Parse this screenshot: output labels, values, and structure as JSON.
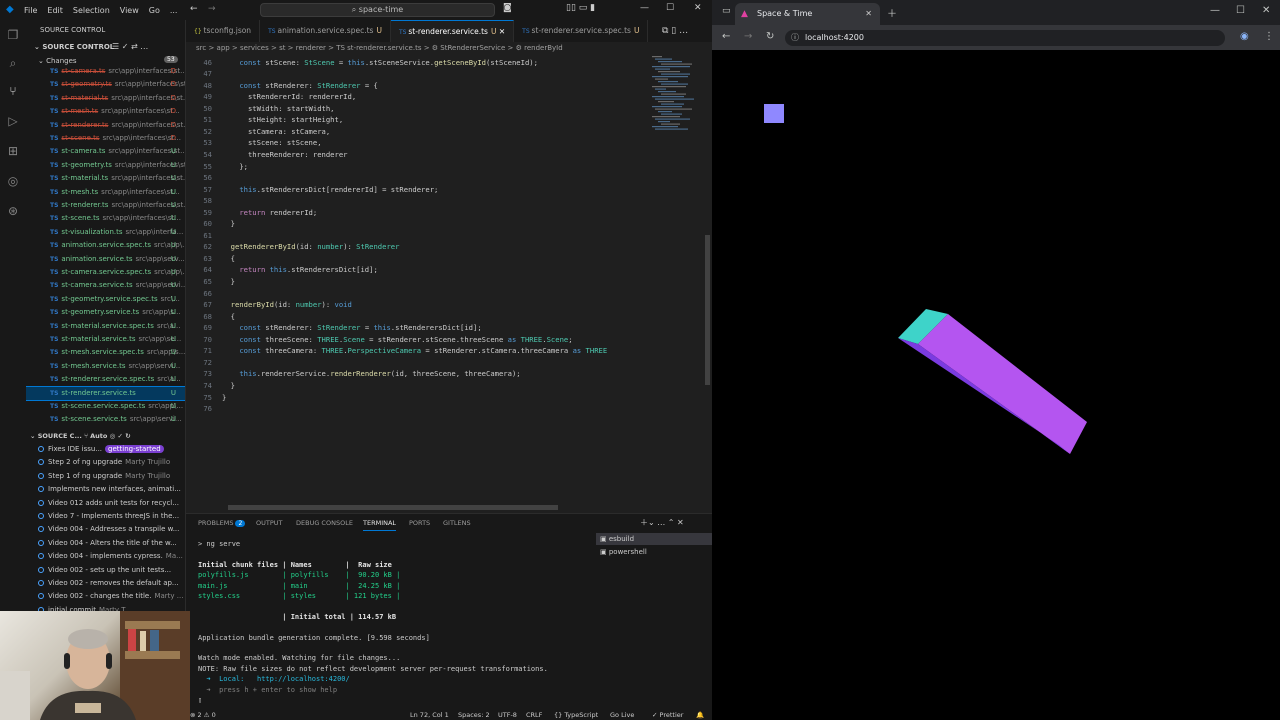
{
  "vscode": {
    "menu": [
      "File",
      "Edit",
      "Selection",
      "View",
      "Go",
      "..."
    ],
    "command_center": "space-time",
    "sidebar": {
      "title": "SOURCE CONTROL",
      "section": "SOURCE CONTROL",
      "changes_label": "Changes",
      "changes_count": "53",
      "files": [
        {
          "name": "st-camera.ts",
          "path": "src\\app\\interfaces\\st...",
          "status": "D"
        },
        {
          "name": "st-geometry.ts",
          "path": "src\\app\\interfaces\\st...",
          "status": "D"
        },
        {
          "name": "st-material.ts",
          "path": "src\\app\\interfaces\\st...",
          "status": "D"
        },
        {
          "name": "st-mesh.ts",
          "path": "src\\app\\interfaces\\st...",
          "status": "D"
        },
        {
          "name": "st-renderer.ts",
          "path": "src\\app\\interfaces\\st...",
          "status": "D"
        },
        {
          "name": "st-scene.ts",
          "path": "src\\app\\interfaces\\st...",
          "status": "D"
        },
        {
          "name": "st-camera.ts",
          "path": "src\\app\\interfaces\\st...",
          "status": "U"
        },
        {
          "name": "st-geometry.ts",
          "path": "src\\app\\interfaces\\st...",
          "status": "U"
        },
        {
          "name": "st-material.ts",
          "path": "src\\app\\interfaces\\st...",
          "status": "U"
        },
        {
          "name": "st-mesh.ts",
          "path": "src\\app\\interfaces\\st...",
          "status": "U"
        },
        {
          "name": "st-renderer.ts",
          "path": "src\\app\\interfaces\\st...",
          "status": "U"
        },
        {
          "name": "st-scene.ts",
          "path": "src\\app\\interfaces\\st...",
          "status": "U"
        },
        {
          "name": "st-visualization.ts",
          "path": "src\\app\\interfa...",
          "status": "U"
        },
        {
          "name": "animation.service.spec.ts",
          "path": "src\\app\\...",
          "status": "U"
        },
        {
          "name": "animation.service.ts",
          "path": "src\\app\\serv...",
          "status": "U"
        },
        {
          "name": "st-camera.service.spec.ts",
          "path": "src\\app\\...",
          "status": "U"
        },
        {
          "name": "st-camera.service.ts",
          "path": "src\\app\\servi...",
          "status": "U"
        },
        {
          "name": "st-geometry.service.spec.ts",
          "path": "src\\...",
          "status": "U"
        },
        {
          "name": "st-geometry.service.ts",
          "path": "src\\app\\s...",
          "status": "U"
        },
        {
          "name": "st-material.service.spec.ts",
          "path": "src\\a...",
          "status": "U"
        },
        {
          "name": "st-material.service.ts",
          "path": "src\\app\\se...",
          "status": "U"
        },
        {
          "name": "st-mesh.service.spec.ts",
          "path": "src\\app\\s...",
          "status": "U"
        },
        {
          "name": "st-mesh.service.ts",
          "path": "src\\app\\servi...",
          "status": "U"
        },
        {
          "name": "st-renderer.service.spec.ts",
          "path": "src\\a...",
          "status": "U"
        },
        {
          "name": "st-renderer.service.ts",
          "path": "",
          "status": "U"
        },
        {
          "name": "st-scene.service.spec.ts",
          "path": "src\\app\\...",
          "status": "U"
        },
        {
          "name": "st-scene.service.ts",
          "path": "src\\app\\servi...",
          "status": "U"
        }
      ],
      "graph_title": "SOURCE C...",
      "graph_auto": "Auto",
      "commits": [
        {
          "msg": "Fixes IDE issu...",
          "author": "getting-started"
        },
        {
          "msg": "Step 2 of ng upgrade",
          "author": "Marty Trujillo"
        },
        {
          "msg": "Step 1 of ng upgrade",
          "author": "Marty Trujillo"
        },
        {
          "msg": "Implements new interfaces, animati...",
          "author": ""
        },
        {
          "msg": "Video 012 adds unit tests for recycl...",
          "author": ""
        },
        {
          "msg": "Video 7 - Implements threeJS in the...",
          "author": ""
        },
        {
          "msg": "Video 004 - Addresses a transpile w...",
          "author": ""
        },
        {
          "msg": "Video 004 - Alters the title of the w...",
          "author": ""
        },
        {
          "msg": "Video 004 - implements cypress.",
          "author": "Ma..."
        },
        {
          "msg": "Video 002 - sets up the unit tests...",
          "author": ""
        },
        {
          "msg": "Video 002 - removes the default ap...",
          "author": ""
        },
        {
          "msg": "Video 002 - changes the title.",
          "author": "Marty ..."
        },
        {
          "msg": "initial commit",
          "author": "Marty T..."
        }
      ]
    },
    "tabs": [
      {
        "label": "tsconfig.json",
        "mod": ""
      },
      {
        "label": "animation.service.spec.ts",
        "mod": "U"
      },
      {
        "label": "st-renderer.service.ts",
        "mod": "U"
      },
      {
        "label": "st-renderer.service.spec.ts",
        "mod": "U"
      }
    ],
    "breadcrumb": "src > app > services > st > renderer > TS st-renderer.service.ts > ⚙ StRendererService > ⚙ renderById",
    "code_lines": [
      {
        "n": "45",
        "t": "    const stSceneId = this.stSceneService.createBaseScene();"
      },
      {
        "n": "46",
        "t": "    const stScene: StScene = this.stSceneService.getSceneById(stSceneId);"
      },
      {
        "n": "47",
        "t": ""
      },
      {
        "n": "48",
        "t": "    const stRenderer: StRenderer = {"
      },
      {
        "n": "49",
        "t": "      stRendererId: rendererId,"
      },
      {
        "n": "50",
        "t": "      stWidth: startWidth,"
      },
      {
        "n": "51",
        "t": "      stHeight: startHeight,"
      },
      {
        "n": "52",
        "t": "      stCamera: stCamera,"
      },
      {
        "n": "53",
        "t": "      stScene: stScene,"
      },
      {
        "n": "54",
        "t": "      threeRenderer: renderer"
      },
      {
        "n": "55",
        "t": "    };"
      },
      {
        "n": "56",
        "t": ""
      },
      {
        "n": "57",
        "t": "    this.stRenderersDict[rendererId] = stRenderer;"
      },
      {
        "n": "58",
        "t": ""
      },
      {
        "n": "59",
        "t": "    return rendererId;"
      },
      {
        "n": "60",
        "t": "  }"
      },
      {
        "n": "61",
        "t": ""
      },
      {
        "n": "62",
        "t": "  getRendererById(id: number): StRenderer"
      },
      {
        "n": "63",
        "t": "  {"
      },
      {
        "n": "64",
        "t": "    return this.stRenderersDict[id];"
      },
      {
        "n": "65",
        "t": "  }"
      },
      {
        "n": "66",
        "t": ""
      },
      {
        "n": "67",
        "t": "  renderById(id: number): void"
      },
      {
        "n": "68",
        "t": "  {"
      },
      {
        "n": "69",
        "t": "    const stRenderer: StRenderer = this.stRenderersDict[id];"
      },
      {
        "n": "70",
        "t": "    const threeScene: THREE.Scene = stRenderer.stScene.threeScene as THREE.Scene;"
      },
      {
        "n": "71",
        "t": "    const threeCamera: THREE.PerspectiveCamera = stRenderer.stCamera.threeCamera as THREE"
      },
      {
        "n": "72",
        "t": ""
      },
      {
        "n": "73",
        "t": "    this.rendererService.renderRenderer(id, threeScene, threeCamera);"
      },
      {
        "n": "74",
        "t": "  }"
      },
      {
        "n": "75",
        "t": "}"
      },
      {
        "n": "76",
        "t": ""
      }
    ],
    "panel": {
      "tabs": [
        "PROBLEMS",
        "OUTPUT",
        "DEBUG CONSOLE",
        "TERMINAL",
        "PORTS",
        "GITLENS"
      ],
      "problems_count": "2",
      "terminal_sessions": [
        "esbuild",
        "powershell"
      ],
      "terminal_lines": [
        {
          "t": "> ng serve",
          "c": ""
        },
        {
          "t": "",
          "c": ""
        },
        {
          "t": "Initial chunk files | Names        |  Raw size",
          "c": "bold"
        },
        {
          "t": "polyfills.js        | polyfills    |  90.20 kB |",
          "c": "green"
        },
        {
          "t": "main.js             | main         |  24.25 kB |",
          "c": "green"
        },
        {
          "t": "styles.css          | styles       | 121 bytes |",
          "c": "green"
        },
        {
          "t": "",
          "c": ""
        },
        {
          "t": "                    | Initial total | 114.57 kB",
          "c": "bold"
        },
        {
          "t": "",
          "c": ""
        },
        {
          "t": "Application bundle generation complete. [9.598 seconds]",
          "c": ""
        },
        {
          "t": "",
          "c": ""
        },
        {
          "t": "Watch mode enabled. Watching for file changes...",
          "c": ""
        },
        {
          "t": "NOTE: Raw file sizes do not reflect development server per-request transformations.",
          "c": ""
        },
        {
          "t": "  ➜  Local:   http://localhost:4200/",
          "c": "cyan"
        },
        {
          "t": "  ➜  press h + enter to show help",
          "c": "dim"
        }
      ]
    },
    "status": {
      "left": "⊗ 2 ⚠ 0",
      "position": "Ln 72, Col 1",
      "spaces": "Spaces: 2",
      "encoding": "UTF-8",
      "eol": "CRLF",
      "language": "{} TypeScript",
      "golive": "Go Live",
      "prettier": "✓ Prettier"
    }
  },
  "browser": {
    "tab_title": "Space & Time",
    "url": "localhost:4200"
  },
  "colors": {
    "box_top": "#3ed3c9",
    "box_side": "#b455f0",
    "box_front": "#7b3be0",
    "small_square": "#8f88ff"
  }
}
